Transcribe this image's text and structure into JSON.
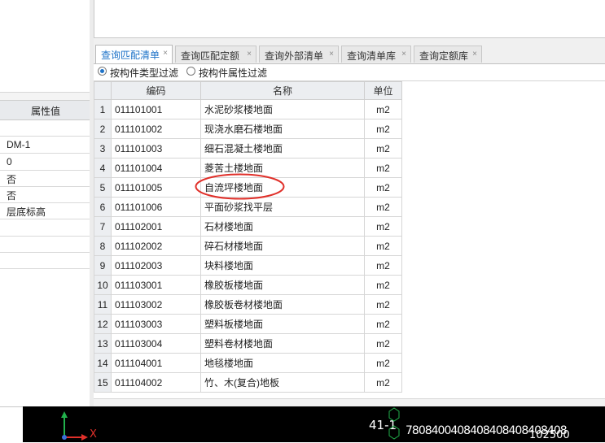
{
  "left_panel": {
    "header": "属性值",
    "values": [
      "",
      "DM-1",
      "0",
      "否",
      "否",
      "层底标高",
      "",
      "",
      ""
    ]
  },
  "tabs": [
    {
      "label": "查询匹配清单",
      "active": true
    },
    {
      "label": "查询匹配定额",
      "active": false
    },
    {
      "label": "查询外部清单",
      "active": false
    },
    {
      "label": "查询清单库",
      "active": false
    },
    {
      "label": "查询定额库",
      "active": false
    }
  ],
  "tab_close": "×",
  "filters": {
    "by_type": "按构件类型过滤",
    "by_attribute": "按构件属性过滤"
  },
  "grid": {
    "headers": {
      "code": "编码",
      "name": "名称",
      "unit": "单位"
    },
    "rows": [
      {
        "n": "1",
        "code": "011101001",
        "name": "水泥砂浆楼地面",
        "unit": "m2"
      },
      {
        "n": "2",
        "code": "011101002",
        "name": "现浇水磨石楼地面",
        "unit": "m2"
      },
      {
        "n": "3",
        "code": "011101003",
        "name": "细石混凝土楼地面",
        "unit": "m2"
      },
      {
        "n": "4",
        "code": "011101004",
        "name": "菱苦土楼地面",
        "unit": "m2"
      },
      {
        "n": "5",
        "code": "011101005",
        "name": "自流坪楼地面",
        "unit": "m2"
      },
      {
        "n": "6",
        "code": "011101006",
        "name": "平面砂浆找平层",
        "unit": "m2"
      },
      {
        "n": "7",
        "code": "011102001",
        "name": "石材楼地面",
        "unit": "m2"
      },
      {
        "n": "8",
        "code": "011102002",
        "name": "碎石材楼地面",
        "unit": "m2"
      },
      {
        "n": "9",
        "code": "011102003",
        "name": "块料楼地面",
        "unit": "m2"
      },
      {
        "n": "10",
        "code": "011103001",
        "name": "橡胶板楼地面",
        "unit": "m2"
      },
      {
        "n": "11",
        "code": "011103002",
        "name": "橡胶板卷材楼地面",
        "unit": "m2"
      },
      {
        "n": "12",
        "code": "011103003",
        "name": "塑料板楼地面",
        "unit": "m2"
      },
      {
        "n": "13",
        "code": "011103004",
        "name": "塑料卷材楼地面",
        "unit": "m2"
      },
      {
        "n": "14",
        "code": "011104001",
        "name": "地毯楼地面",
        "unit": "m2"
      },
      {
        "n": "15",
        "code": "011104002",
        "name": "竹、木(复合)地板",
        "unit": "m2"
      }
    ],
    "highlight_color": "#e0302a"
  },
  "cad": {
    "axis_x": "X",
    "coord_label": "41-1",
    "dims": "7808400408408408408408408",
    "dim_total": "102500",
    "axis_x_color": "#e0302a",
    "axis_y_color": "#22b14c"
  }
}
